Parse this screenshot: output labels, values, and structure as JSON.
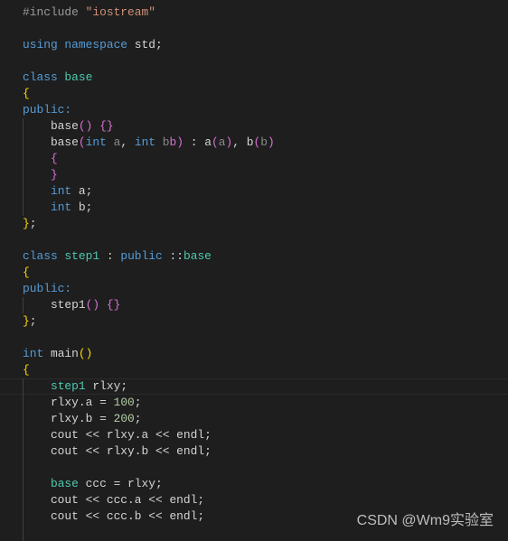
{
  "editor": {
    "language": "cpp",
    "colors": {
      "background": "#1e1e1e",
      "keyword": "#569cd6",
      "type": "#4ec9b0",
      "string": "#ce9178",
      "number": "#b5cea8",
      "bracket1": "#ffd700",
      "bracket2": "#da70d6"
    },
    "current_line": 24,
    "lines": [
      {
        "guide": false,
        "tokens": [
          [
            "    ",
            "txt"
          ]
        ]
      },
      {
        "guide": false,
        "tokens": [
          [
            "#include ",
            "pp"
          ],
          [
            "\"iostream\"",
            "str"
          ]
        ]
      },
      {
        "guide": false,
        "tokens": []
      },
      {
        "guide": false,
        "tokens": [
          [
            "using ",
            "kw"
          ],
          [
            "namespace ",
            "kw"
          ],
          [
            "std;",
            "txt"
          ]
        ]
      },
      {
        "guide": false,
        "tokens": []
      },
      {
        "guide": false,
        "tokens": [
          [
            "class ",
            "kw"
          ],
          [
            "base",
            "ty"
          ]
        ]
      },
      {
        "guide": false,
        "tokens": [
          [
            "{",
            "b1"
          ]
        ]
      },
      {
        "guide": false,
        "tokens": [
          [
            "public:",
            "kw"
          ]
        ]
      },
      {
        "guide": true,
        "tokens": [
          [
            "    base",
            "txt"
          ],
          [
            "()",
            "b2"
          ],
          [
            " ",
            "txt"
          ],
          [
            "{}",
            "b2"
          ]
        ]
      },
      {
        "guide": true,
        "tokens": [
          [
            "    base",
            "txt"
          ],
          [
            "(",
            "b2"
          ],
          [
            "int ",
            "kw"
          ],
          [
            "a",
            "dim"
          ],
          [
            ", ",
            "txt"
          ],
          [
            "int ",
            "kw"
          ],
          [
            "b",
            "dim"
          ],
          [
            "b)",
            "b2"
          ],
          [
            " : a",
            "txt"
          ],
          [
            "(",
            "b2"
          ],
          [
            "a",
            "dim"
          ],
          [
            ")",
            "b2"
          ],
          [
            ", b",
            "txt"
          ],
          [
            "(",
            "b2"
          ],
          [
            "b",
            "dim"
          ],
          [
            ")",
            "b2"
          ]
        ]
      },
      {
        "guide": true,
        "tokens": [
          [
            "    ",
            "txt"
          ],
          [
            "{",
            "b2"
          ]
        ]
      },
      {
        "guide": true,
        "tokens": [
          [
            "    ",
            "txt"
          ],
          [
            "}",
            "b2"
          ]
        ]
      },
      {
        "guide": true,
        "tokens": [
          [
            "    ",
            "txt"
          ],
          [
            "int ",
            "kw"
          ],
          [
            "a;",
            "txt"
          ]
        ]
      },
      {
        "guide": true,
        "tokens": [
          [
            "    ",
            "txt"
          ],
          [
            "int ",
            "kw"
          ],
          [
            "b;",
            "txt"
          ]
        ]
      },
      {
        "guide": false,
        "tokens": [
          [
            "}",
            "b1"
          ],
          [
            ";",
            "txt"
          ]
        ]
      },
      {
        "guide": false,
        "tokens": []
      },
      {
        "guide": false,
        "tokens": [
          [
            "class ",
            "kw"
          ],
          [
            "step1",
            "ty"
          ],
          [
            " : ",
            "txt"
          ],
          [
            "public ",
            "kw"
          ],
          [
            "::",
            "txt"
          ],
          [
            "base",
            "ty"
          ]
        ]
      },
      {
        "guide": false,
        "tokens": [
          [
            "{",
            "b1"
          ]
        ]
      },
      {
        "guide": false,
        "tokens": [
          [
            "public:",
            "kw"
          ]
        ]
      },
      {
        "guide": true,
        "tokens": [
          [
            "    step1",
            "txt"
          ],
          [
            "()",
            "b2"
          ],
          [
            " ",
            "txt"
          ],
          [
            "{}",
            "b2"
          ]
        ]
      },
      {
        "guide": false,
        "tokens": [
          [
            "}",
            "b1"
          ],
          [
            ";",
            "txt"
          ]
        ]
      },
      {
        "guide": false,
        "tokens": []
      },
      {
        "guide": false,
        "tokens": [
          [
            "int ",
            "kw"
          ],
          [
            "main",
            "txt"
          ],
          [
            "()",
            "b1"
          ]
        ]
      },
      {
        "guide": false,
        "tokens": [
          [
            "{",
            "b1"
          ]
        ]
      },
      {
        "guide": true,
        "tokens": [
          [
            "    ",
            "txt"
          ],
          [
            "step1",
            "ty"
          ],
          [
            " rlxy;",
            "txt"
          ]
        ]
      },
      {
        "guide": true,
        "tokens": [
          [
            "    rlxy.a = ",
            "txt"
          ],
          [
            "100",
            "num"
          ],
          [
            ";",
            "txt"
          ]
        ]
      },
      {
        "guide": true,
        "tokens": [
          [
            "    rlxy.b = ",
            "txt"
          ],
          [
            "200",
            "num"
          ],
          [
            ";",
            "txt"
          ]
        ]
      },
      {
        "guide": true,
        "tokens": [
          [
            "    cout << rlxy.a << endl;",
            "txt"
          ]
        ]
      },
      {
        "guide": true,
        "tokens": [
          [
            "    cout << rlxy.b << endl;",
            "txt"
          ]
        ]
      },
      {
        "guide": true,
        "tokens": []
      },
      {
        "guide": true,
        "tokens": [
          [
            "    ",
            "txt"
          ],
          [
            "base",
            "ty"
          ],
          [
            " ccc = rlxy;",
            "txt"
          ]
        ]
      },
      {
        "guide": true,
        "tokens": [
          [
            "    cout << ccc.a << endl;",
            "txt"
          ]
        ]
      },
      {
        "guide": true,
        "tokens": [
          [
            "    cout << ccc.b << endl;",
            "txt"
          ]
        ]
      },
      {
        "guide": true,
        "tokens": []
      }
    ]
  },
  "watermark": "CSDN @Wm9实验室"
}
